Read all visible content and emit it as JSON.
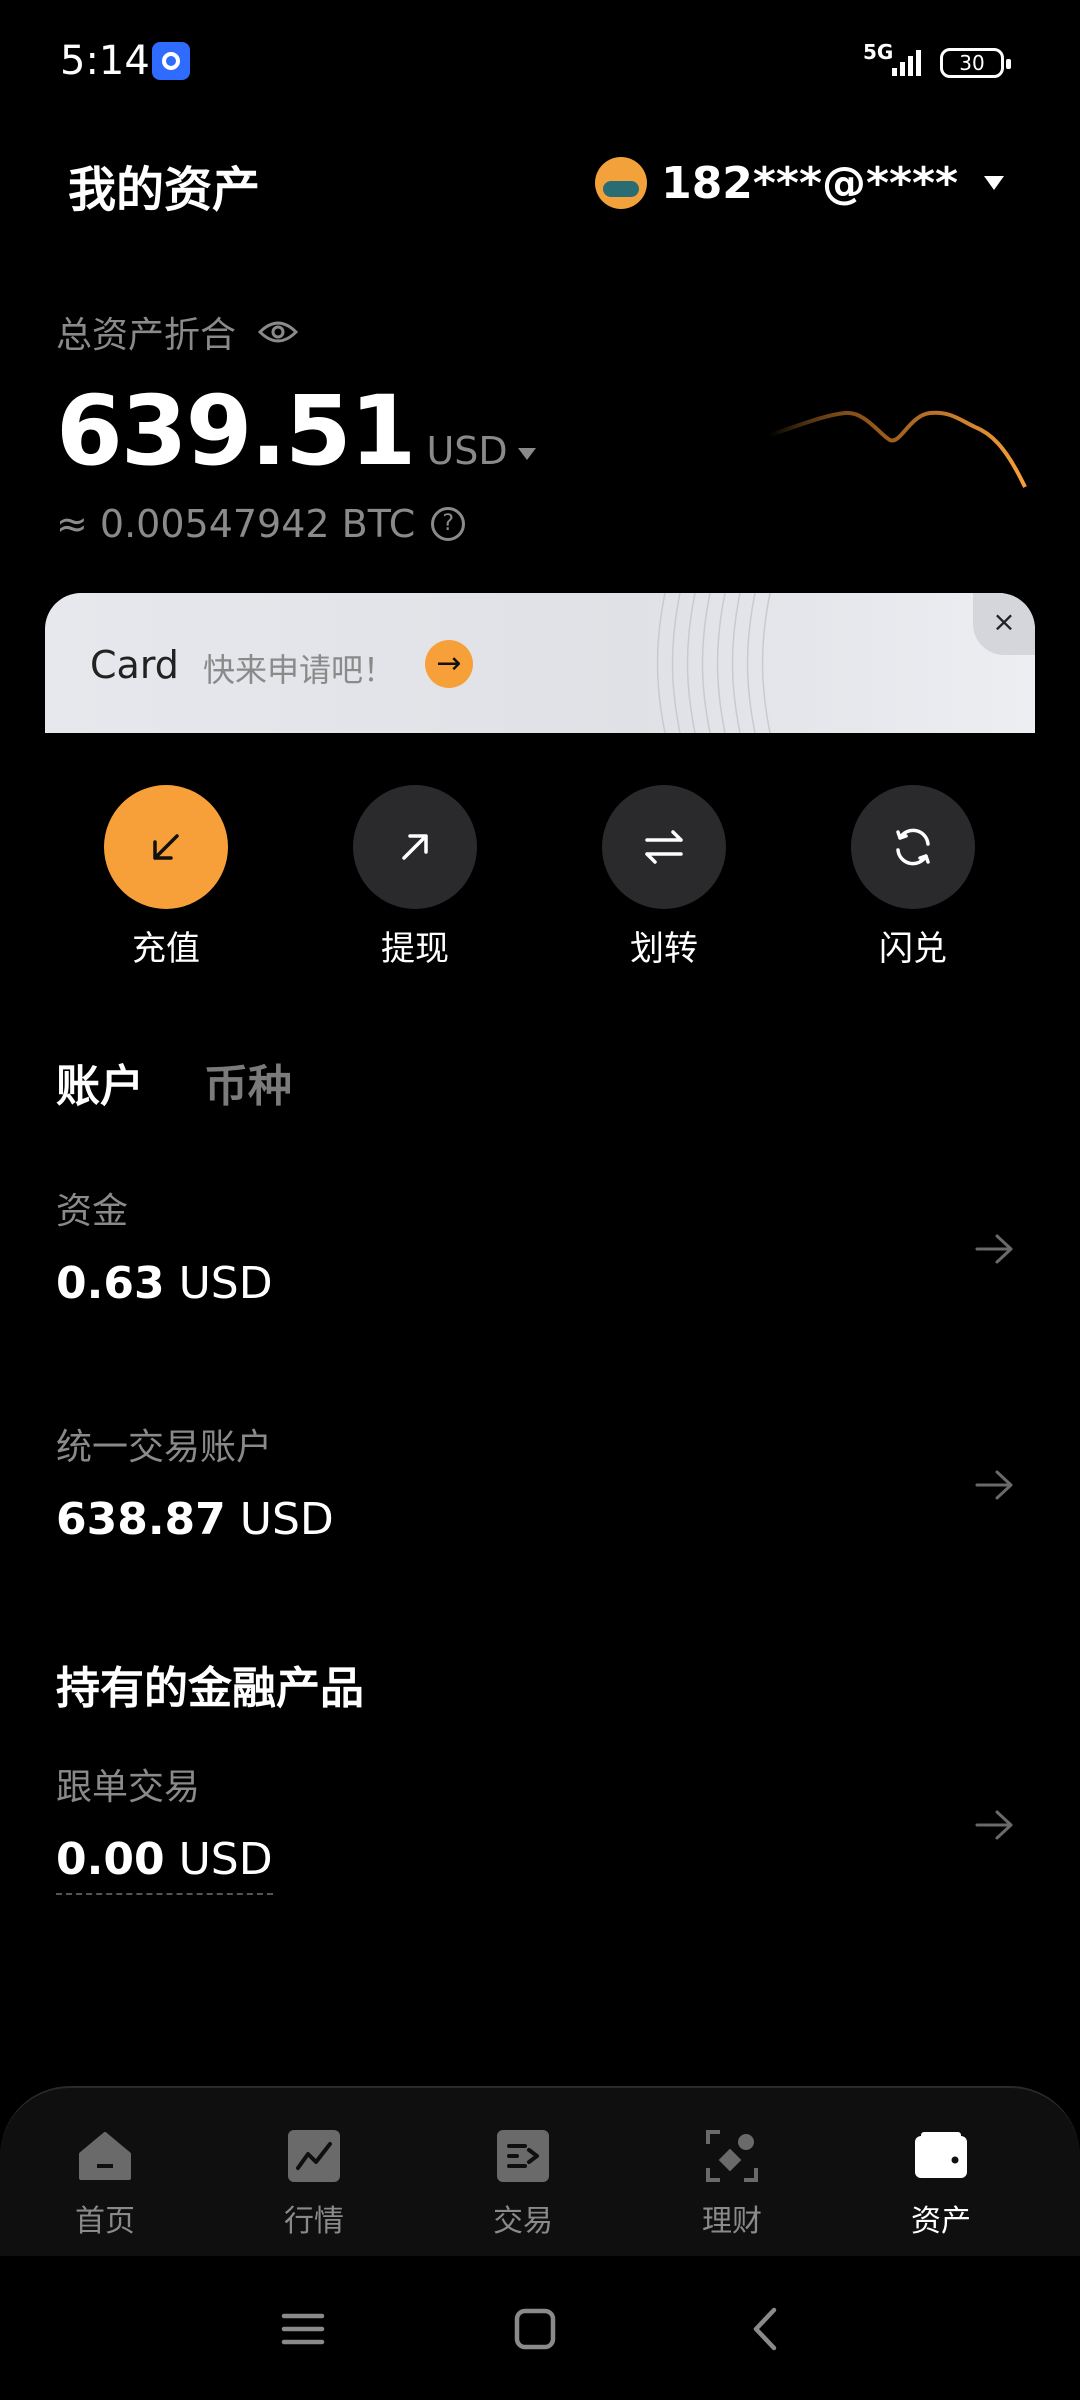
{
  "status_bar": {
    "time": "5:14",
    "network": "5G",
    "battery": "30"
  },
  "header": {
    "title": "我的资产",
    "account": "182***@****"
  },
  "total_assets": {
    "label": "总资产折合",
    "value": "639.51",
    "currency": "USD",
    "btc_equivalent": "≈ 0.00547942 BTC"
  },
  "banner": {
    "card_label": "Card",
    "text": "快来申请吧！",
    "close": "×"
  },
  "actions": [
    {
      "label": "充值",
      "icon": "deposit-arrow-icon"
    },
    {
      "label": "提现",
      "icon": "withdraw-arrow-icon"
    },
    {
      "label": "划转",
      "icon": "transfer-icon"
    },
    {
      "label": "闪兑",
      "icon": "swap-icon"
    }
  ],
  "tabs": [
    {
      "label": "账户",
      "active": true
    },
    {
      "label": "币种",
      "active": false
    }
  ],
  "accounts": [
    {
      "label": "资金",
      "amount": "0.63",
      "currency": "USD"
    },
    {
      "label": "统一交易账户",
      "amount": "638.87",
      "currency": "USD"
    }
  ],
  "financial_products": {
    "title": "持有的金融产品",
    "items": [
      {
        "label": "跟单交易",
        "amount": "0.00",
        "currency": "USD"
      }
    ]
  },
  "bottom_nav": [
    {
      "label": "首页",
      "icon": "home-icon",
      "active": false
    },
    {
      "label": "行情",
      "icon": "market-chart-icon",
      "active": false
    },
    {
      "label": "交易",
      "icon": "trade-icon",
      "active": false
    },
    {
      "label": "理财",
      "icon": "finance-icon",
      "active": false
    },
    {
      "label": "资产",
      "icon": "wallet-icon",
      "active": true
    }
  ],
  "colors": {
    "accent": "#f7a03a",
    "background": "#000000",
    "muted_text": "#8a8a8a"
  }
}
